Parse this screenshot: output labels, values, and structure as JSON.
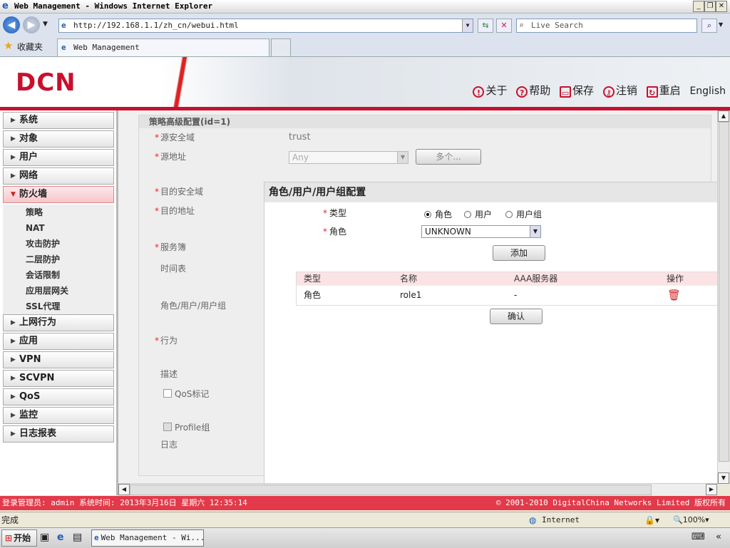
{
  "window": {
    "title": "Web Management - Windows Internet Explorer",
    "address": "http://192.168.1.1/zh_cn/webui.html",
    "search_placeholder": "Live Search",
    "favorites_label": "收藏夹",
    "tab_label": "Web Management"
  },
  "header": {
    "logo": "DCN",
    "links": [
      {
        "label": "关于",
        "icon": "info-icon"
      },
      {
        "label": "帮助",
        "icon": "help-icon"
      },
      {
        "label": "保存",
        "icon": "save-icon"
      },
      {
        "label": "注销",
        "icon": "logout-key-icon"
      },
      {
        "label": "重启",
        "icon": "restart-icon"
      }
    ],
    "english_label": "English"
  },
  "sidebar": {
    "items": [
      {
        "label": "系统"
      },
      {
        "label": "对象"
      },
      {
        "label": "用户"
      },
      {
        "label": "网络"
      },
      {
        "label": "防火墙"
      },
      {
        "label": "上网行为"
      },
      {
        "label": "应用"
      },
      {
        "label": "VPN"
      },
      {
        "label": "SCVPN"
      },
      {
        "label": "QoS"
      },
      {
        "label": "监控"
      },
      {
        "label": "日志报表"
      }
    ],
    "subitems": [
      "策略",
      "NAT",
      "攻击防护",
      "二层防护",
      "会话限制",
      "应用层网关",
      "SSL代理"
    ]
  },
  "policy_panel": {
    "title": "策略高级配置(id=1)",
    "fields": {
      "src_zone": {
        "label": "源安全域",
        "value": "trust"
      },
      "src_addr": {
        "label": "源地址",
        "value": "Any",
        "button": "多个..."
      },
      "dst_zone": {
        "label": "目的安全域"
      },
      "dst_addr": {
        "label": "目的地址"
      },
      "service": {
        "label": "服务簿"
      },
      "schedule": {
        "label": "时间表"
      },
      "role_user": {
        "label": "角色/用户/用户组"
      },
      "action": {
        "label": "行为"
      },
      "description": {
        "label": "描述"
      },
      "qos_tag": {
        "label": "QoS标记"
      },
      "profile_group": {
        "label": "Profile组"
      },
      "log": {
        "label": "日志"
      }
    }
  },
  "dialog": {
    "title": "角色/用户/用户组配置",
    "type_label": "类型",
    "type_options": [
      "角色",
      "用户",
      "用户组"
    ],
    "type_selected": "角色",
    "role_label": "角色",
    "role_value": "UNKNOWN",
    "add_button": "添加",
    "confirm_button": "确认",
    "table": {
      "columns": [
        "类型",
        "名称",
        "AAA服务器",
        "操作"
      ],
      "rows": [
        {
          "type": "角色",
          "name": "role1",
          "aaa": "-"
        }
      ]
    }
  },
  "footer": {
    "left": "登录管理员: admin 系统时间: 2013年3月16日 星期六 12:35:14",
    "right": "© 2001-2010 DigitalChina Networks Limited 版权所有"
  },
  "statusbar": {
    "left": "完成",
    "zone": "Internet",
    "zoom": "100%"
  },
  "taskbar": {
    "start": "开始",
    "item": "Web Management - Wi..."
  },
  "colors": {
    "brand": "#c8102e",
    "footer": "#e23a4a",
    "required": "#e23322"
  }
}
